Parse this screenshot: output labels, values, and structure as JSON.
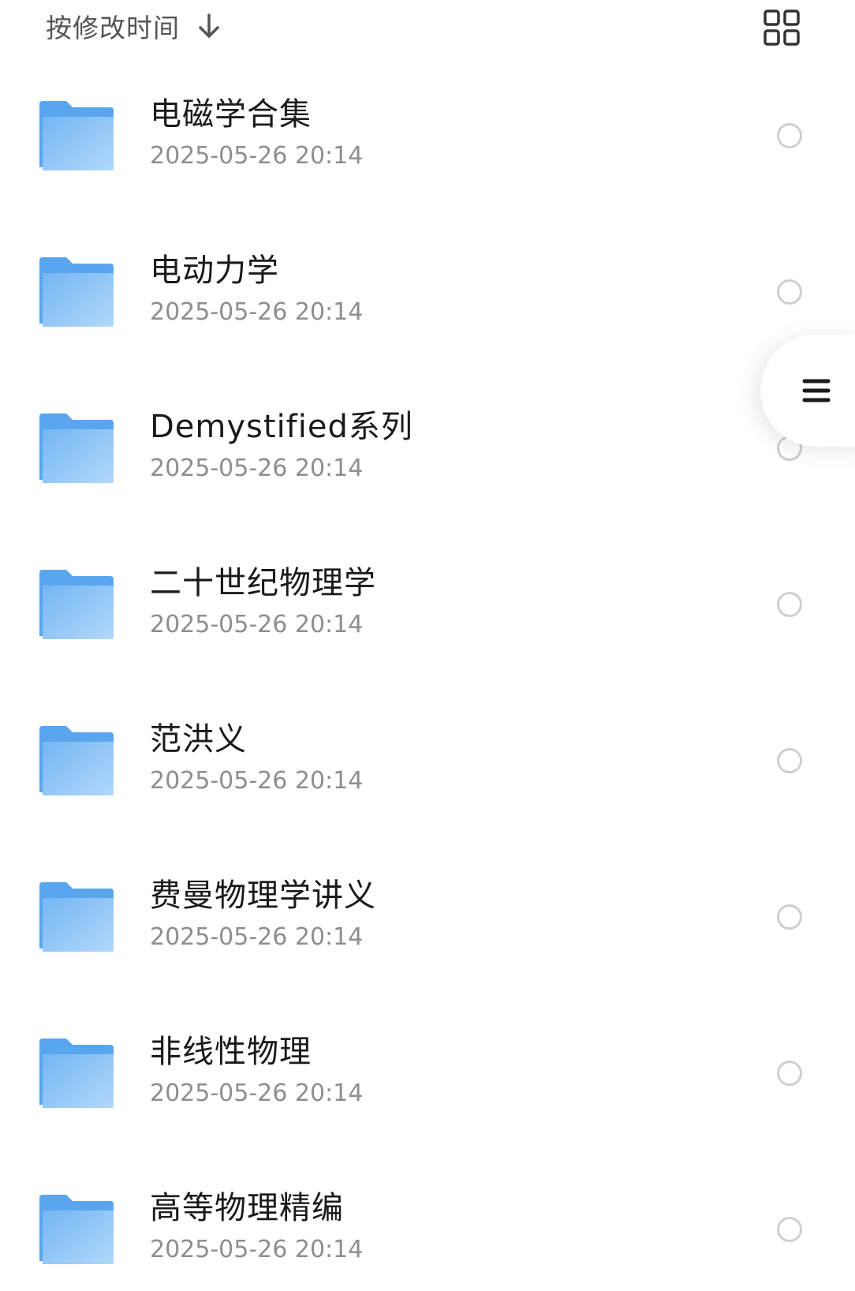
{
  "sort": {
    "label": "按修改时间"
  },
  "icons": {
    "sort_direction": "arrow-down-icon",
    "view_mode": "grid-view-icon",
    "side_menu": "menu-icon",
    "item": "folder-icon"
  },
  "colors": {
    "folder_back": "#5aa6ee",
    "folder_front_top": "#74b6f3",
    "folder_front_bottom": "#b2d8fb",
    "date_text": "#8e8e8e",
    "radio_border": "#cfcfcf"
  },
  "files": [
    {
      "name": "电磁学合集",
      "date": "2025-05-26 20:14"
    },
    {
      "name": "电动力学",
      "date": "2025-05-26 20:14"
    },
    {
      "name": "Demystified系列",
      "date": "2025-05-26 20:14"
    },
    {
      "name": "二十世纪物理学",
      "date": "2025-05-26 20:14"
    },
    {
      "name": "范洪义",
      "date": "2025-05-26 20:14"
    },
    {
      "name": "费曼物理学讲义",
      "date": "2025-05-26 20:14"
    },
    {
      "name": "非线性物理",
      "date": "2025-05-26 20:14"
    },
    {
      "name": "高等物理精编",
      "date": "2025-05-26 20:14"
    }
  ]
}
